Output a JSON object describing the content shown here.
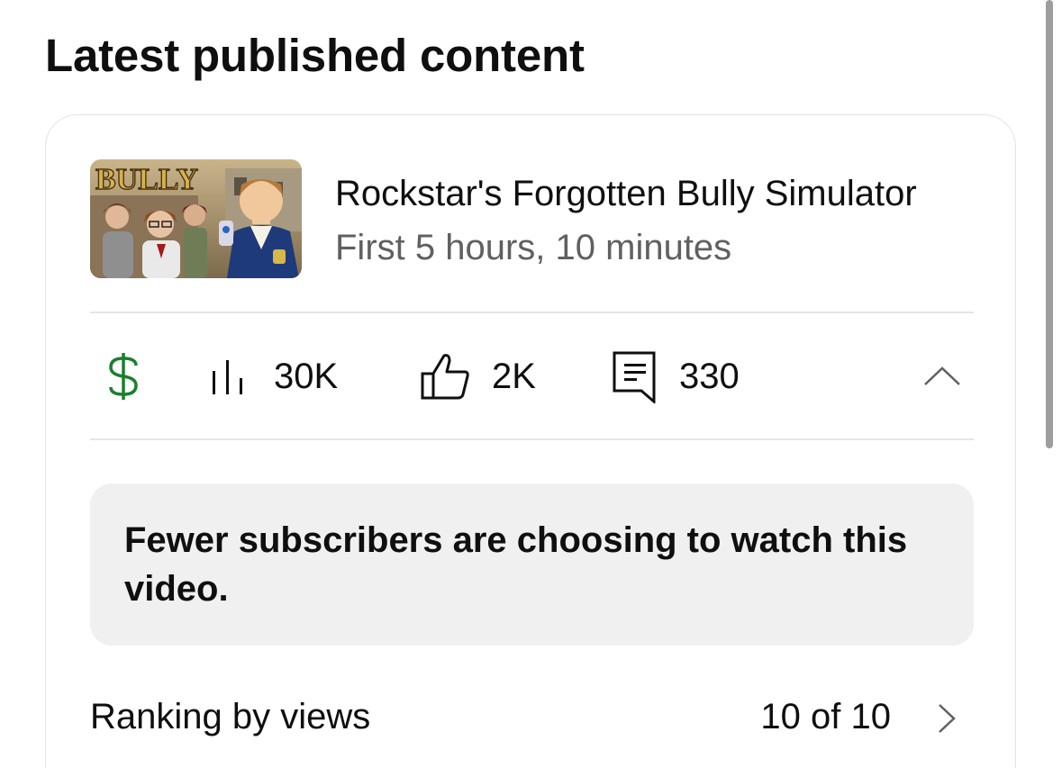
{
  "section": {
    "title": "Latest published content"
  },
  "video": {
    "thumbnail_text": "BULLY",
    "title": "Rockstar's Forgotten Bully Simulator",
    "subtitle": "First 5 hours, 10 minutes"
  },
  "stats": {
    "revenue_icon": "dollar-icon",
    "views": "30K",
    "views_icon": "bar-chart-icon",
    "likes": "2K",
    "likes_icon": "thumbs-up-icon",
    "comments": "330",
    "comments_icon": "comment-icon",
    "collapse_icon": "chevron-up-icon",
    "revenue_color": "#1a7f2e"
  },
  "insight": {
    "text": "Fewer subscribers are choosing to watch this video."
  },
  "ranking": {
    "label": "Ranking by views",
    "value": "10 of 10",
    "chevron_icon": "chevron-right-icon"
  }
}
